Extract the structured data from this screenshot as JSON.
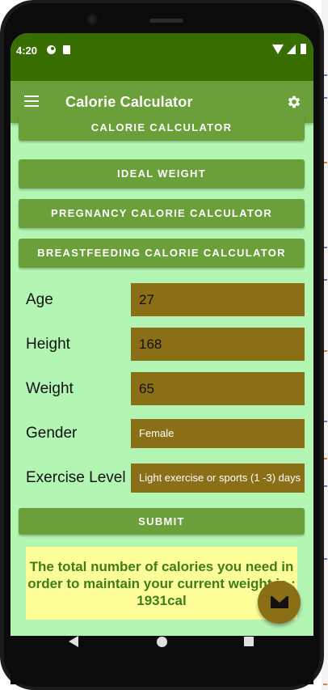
{
  "status_bar": {
    "time": "4:20"
  },
  "app_bar": {
    "title": "Calorie Calculator",
    "menu_icon": "menu-icon",
    "settings_icon": "gear-icon"
  },
  "nav_buttons": [
    "CALORIE CALCULATOR",
    "IDEAL WEIGHT",
    "PREGNANCY CALORIE CALCULATOR",
    "BREASTFEEDING CALORIE CALCULATOR"
  ],
  "form": {
    "age": {
      "label": "Age",
      "value": "27"
    },
    "height": {
      "label": "Height",
      "value": "168"
    },
    "weight": {
      "label": "Weight",
      "value": "65"
    },
    "gender": {
      "label": "Gender",
      "value": "Female"
    },
    "exercise": {
      "label": "Exercise Level",
      "value": "Light exercise or sports (1 -3) days"
    }
  },
  "submit_label": "SUBMIT",
  "result_text": "The total number of calories you need in order to maintain your current weight is : 1931cal",
  "fab_icon": "email-icon",
  "colors": {
    "status_bar": "#386e00",
    "app_bar": "#6a9f3a",
    "background": "#b3f5b3",
    "field": "#8b6f17",
    "result_bg": "#ffff99",
    "result_text": "#3e7d1a"
  }
}
